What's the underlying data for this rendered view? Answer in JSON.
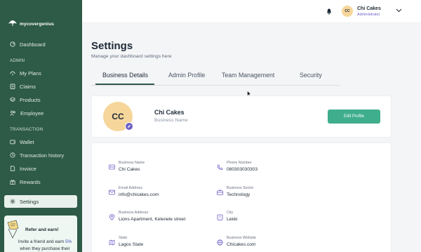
{
  "brand": {
    "name": "mycovergenius"
  },
  "sidebar": {
    "dashboard": "Dashboard",
    "admin_section": "ADMIN",
    "admin_items": [
      "My Plans",
      "Claims",
      "Products",
      "Employee"
    ],
    "transaction_section": "TRANSACTION",
    "transaction_items": [
      "Wallet",
      "Transaction history",
      "Invoice",
      "Rewards"
    ],
    "settings": "Settings",
    "refer": {
      "title": "Refer and earn!",
      "line1_prefix": "Invite a friend and earn ",
      "line1_percent": "5%",
      "line2": "when they purchase their"
    }
  },
  "topbar": {
    "avatar_initials": "CC",
    "user_name": "Chi Cakes",
    "user_role": "Administrator"
  },
  "page": {
    "title": "Settings",
    "subtitle": "Manage your dashboard settings here"
  },
  "tabs": [
    "Business Details",
    "Admin Profile",
    "Team Management",
    "Security"
  ],
  "profile": {
    "initials": "CC",
    "name": "Chi Cakes",
    "subtitle": "Business Name",
    "edit_label": "Edit Profile"
  },
  "details": [
    {
      "label": "Business Name",
      "value": "Chi Cakes",
      "icon": "id-card-icon"
    },
    {
      "label": "Phone Number",
      "value": "080303030303",
      "icon": "phone-icon"
    },
    {
      "label": "Email Address",
      "value": "info@chicakes.com",
      "icon": "mail-icon"
    },
    {
      "label": "Business Sector",
      "value": "Technology",
      "icon": "briefcase-icon"
    },
    {
      "label": "Business Address",
      "value": "Lions Apartment, Kelenele street",
      "icon": "location-icon"
    },
    {
      "label": "City",
      "value": "Lekki",
      "icon": "building-icon"
    },
    {
      "label": "State",
      "value": "Lagos State",
      "icon": "map-icon"
    },
    {
      "label": "Business Website",
      "value": "Chicakes.com",
      "icon": "globe-icon"
    }
  ],
  "colors": {
    "sidebar": "#2e5a48",
    "accent": "#3fae8c",
    "purple": "#6b5fc7",
    "avatar": "#f6d69b"
  }
}
